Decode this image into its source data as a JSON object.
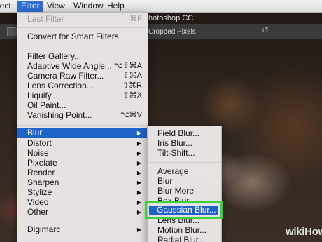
{
  "menubar": {
    "items": [
      "lect",
      "Filter",
      "View",
      "Window",
      "Help"
    ]
  },
  "app_title": "hotoshop CC",
  "options_bar": {
    "cropped_label": "Cropped Pixels"
  },
  "filter_menu": {
    "last_filter": {
      "label": "Last Filter",
      "shortcut": "⌘F"
    },
    "convert": "Convert for Smart Filters",
    "items_a": [
      {
        "label": "Filter Gallery...",
        "shortcut": ""
      },
      {
        "label": "Adaptive Wide Angle...",
        "shortcut": "⌥⇧⌘A"
      },
      {
        "label": "Camera Raw Filter...",
        "shortcut": "⇧⌘A"
      },
      {
        "label": "Lens Correction...",
        "shortcut": "⇧⌘R"
      },
      {
        "label": "Liquify...",
        "shortcut": "⇧⌘X"
      },
      {
        "label": "Oil Paint...",
        "shortcut": ""
      },
      {
        "label": "Vanishing Point...",
        "shortcut": "⌥⌘V"
      }
    ],
    "items_b": [
      "Blur",
      "Distort",
      "Noise",
      "Pixelate",
      "Render",
      "Sharpen",
      "Stylize",
      "Video",
      "Other"
    ],
    "digimarc": "Digimarc"
  },
  "blur_submenu": {
    "items_a": [
      "Field Blur...",
      "Iris Blur...",
      "Tilt-Shift..."
    ],
    "items_b": [
      "Average",
      "Blur",
      "Blur More",
      "Box Blur...",
      "Gaussian Blur...",
      "Lens Blur...",
      "Motion Blur...",
      "Radial Blur..."
    ]
  },
  "watermark": {
    "wiki": "wiki",
    "how": "How"
  },
  "colors": {
    "highlight": "#1f63c8",
    "callout": "#38d13a"
  }
}
